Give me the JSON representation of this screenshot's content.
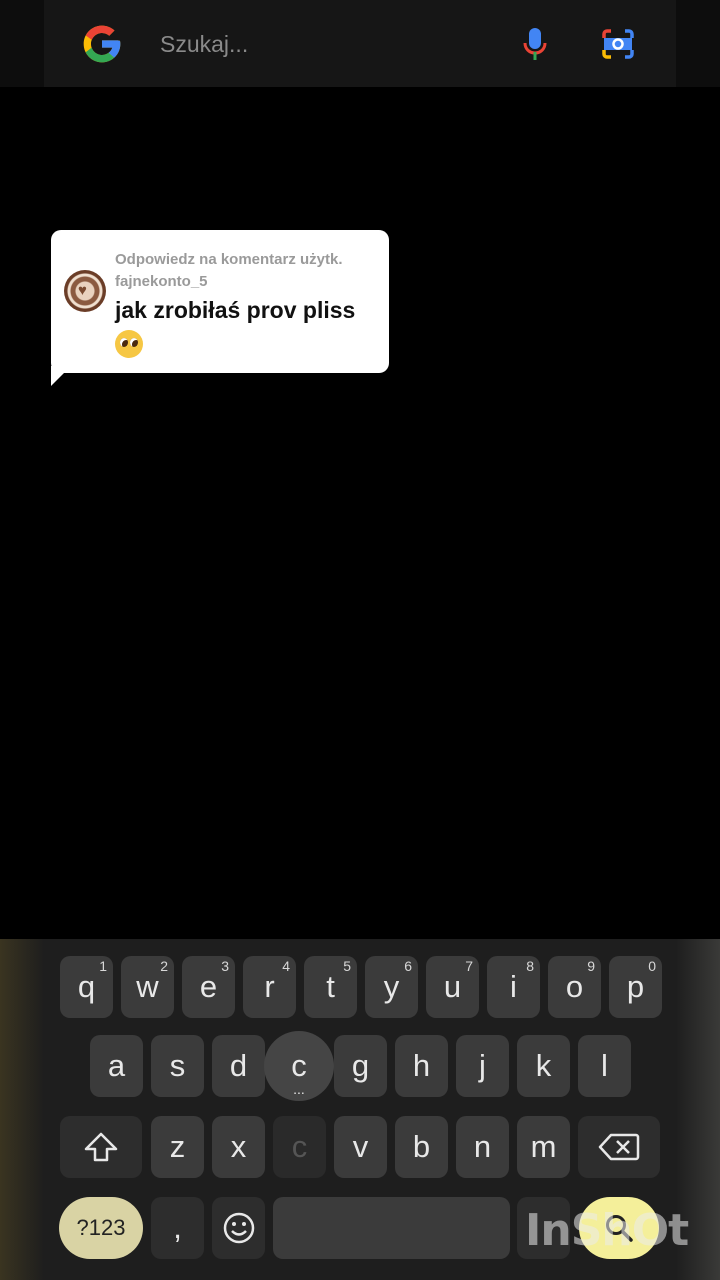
{
  "search": {
    "placeholder": "Szukaj...",
    "logo_icon": "google-g-icon",
    "mic_icon": "microphone-icon",
    "lens_icon": "camera-lens-icon"
  },
  "comment": {
    "reply_line1": "Odpowiedz na komentarz użytk.",
    "reply_line2": "fajnekonto_5",
    "text": "jak zrobiłaś prov pliss",
    "emoji": "pleading-face-emoji"
  },
  "keyboard": {
    "row1": [
      {
        "key": "q",
        "num": "1"
      },
      {
        "key": "w",
        "num": "2"
      },
      {
        "key": "e",
        "num": "3"
      },
      {
        "key": "r",
        "num": "4"
      },
      {
        "key": "t",
        "num": "5"
      },
      {
        "key": "y",
        "num": "6"
      },
      {
        "key": "u",
        "num": "7"
      },
      {
        "key": "i",
        "num": "8"
      },
      {
        "key": "o",
        "num": "9"
      },
      {
        "key": "p",
        "num": "0"
      }
    ],
    "row2": [
      "a",
      "s",
      "d",
      "c",
      "g",
      "h",
      "j",
      "k",
      "l"
    ],
    "row3": [
      "z",
      "x",
      "c",
      "v",
      "b",
      "n",
      "m"
    ],
    "symbols_label": "?123",
    "comma_label": ",",
    "pressed_dots": "..."
  },
  "watermark": "InShOt",
  "colors": {
    "google_blue": "#4285F4",
    "google_red": "#EA4335",
    "google_yellow": "#FBBC05",
    "google_green": "#34A853",
    "search_key": "#f4ef9a"
  }
}
